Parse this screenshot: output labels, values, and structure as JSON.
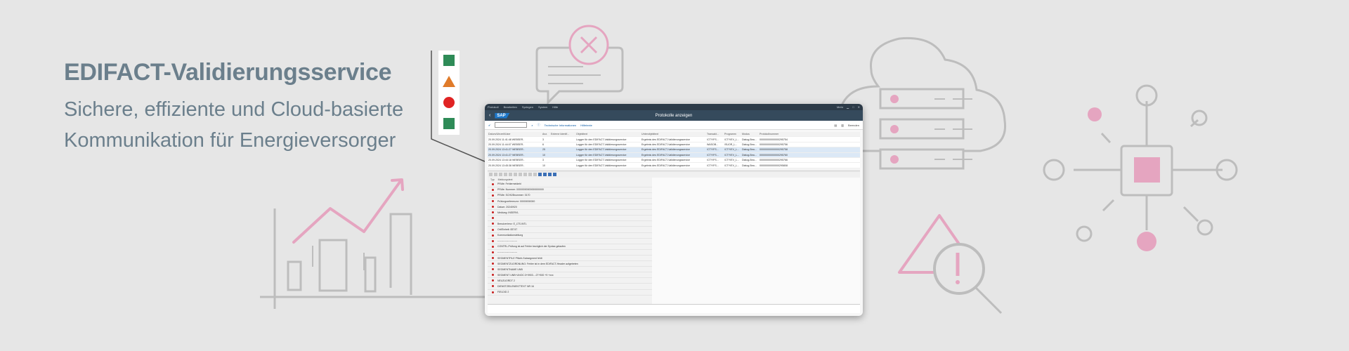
{
  "hero": {
    "headline": "EDIFACT-Validierungsservice",
    "subline_1": "Sichere, effiziente und Cloud-basierte",
    "subline_2": "Kommunikation für Energieversorger"
  },
  "colors": {
    "background": "#e6e6e6",
    "text": "#6b7f8c",
    "accent_pink": "#e5a5c0",
    "line_gray": "#bdbdbd",
    "status_green": "#2e8b57",
    "status_orange": "#e07b2a",
    "status_red": "#e02323",
    "sap_header": "#354a5c",
    "sap_blue": "#1d77c9"
  },
  "status_legend": {
    "icons": [
      "green-square-icon",
      "orange-triangle-icon",
      "red-circle-icon",
      "green-square-icon"
    ]
  },
  "sap": {
    "menu": [
      "Protokoll",
      "Bearbeiten",
      "Springen",
      "System",
      "Hilfe"
    ],
    "menu_right": "Mehr",
    "logo": "SAP",
    "title": "Protokolle anzeigen",
    "toolbar": {
      "technical_info": "Technische Informationen",
      "help": "Hilfetexte",
      "more": "Beenden"
    },
    "columns": [
      "Datum/Uhrzeit/User",
      "Anz.",
      "Externe Identif...",
      "Objekttext",
      "Unterobjekttext",
      "Transakt...",
      "Programm",
      "Modus",
      "Protokollnummer"
    ],
    "rows": [
      [
        "20.09.2024  11:41:48  WEBSER..",
        "3",
        "",
        "Logger für den EDIFACT-Validierungsservice",
        "Ergebnis des EDIFACT-Validierungsservice",
        "/CTY/FS...",
        "/CTY/EV_L...",
        "Dialog-Bea...",
        "00000000000000295754"
      ],
      [
        "20.09.2024  11:44:07  WEBSER..",
        "6",
        "",
        "Logger für den EDIFACT-Validierungsservice",
        "Ergebnis des EDIFACT-Validierungsservice",
        "WASOB...",
        "/SUOR_L...",
        "Dialog-Bea...",
        "00000000000000295756"
      ],
      [
        "20.09.2024  13:41:27  WEBSER..",
        "25",
        "",
        "Logger für den EDIFACT-Validierungsservice",
        "Ergebnis des EDIFACT-Validierungsservice",
        "/CTY/FS...",
        "/CTY/EV_L...",
        "Dialog-Bea...",
        "00000000000000295758"
      ],
      [
        "20.09.2024  13:41:27  WEBSER..",
        "10",
        "",
        "Logger für den EDIFACT-Validierungsservice",
        "Ergebnis des EDIFACT-Validierungsservice",
        "/CTY/FS...",
        "/CTY/EV_L...",
        "Dialog-Bea...",
        "00000000000000295760"
      ],
      [
        "20.09.2024  13:44:18  WEBSER..",
        "3",
        "",
        "Logger für den EDIFACT-Validierungsservice",
        "Ergebnis des EDIFACT-Validierungsservice",
        "/CTY/FS...",
        "/CTY/EV_L...",
        "Dialog-Bea...",
        "00000000000000295766"
      ],
      [
        "20.09.2024  13:45:38  WEBSER..",
        "10",
        "",
        "Logger für den EDIFACT-Validierungsservice",
        "Ergebnis des EDIFACT-Validierungsservice",
        "/CTY/FS...",
        "/CTY/EV_L...",
        "Dialog-Bea...",
        "00000000000000295808"
      ]
    ],
    "log_header": [
      "Typ",
      "Meldungstext"
    ],
    "log_lines": [
      "PRüfe: Fehlermeldehl",
      "PRüfe: Nummer: 00000000000000000000",
      "PRüfe: SCHÜBnummer: 0170",
      "Prüfungsreferenznr: 00000000000",
      "Datum: 20240920",
      "Meldung: INSERVL",
      "",
      "Benutzer/env: E_LTS.INTL",
      "Ort/Einheit: 83747",
      "Kommunikationsleitung",
      "------------------------",
      "CONTRL-Prüfung ist auf Fehler bezüglich der Syntax gelaufen",
      "------------------------",
      "SEGMENTFILE Pflicht-Subsegment fehlt",
      "SEGMENTZUORDNUNG: Fehler ist in dem EDIFACT-Header aufgetreten",
      "SEGMENTNAME UNB",
      "SEGMENT UNB+UNOC:3+9903...:27+500 +9 +xxx",
      "NEUZUORDT 2",
      "DIENSTZEILENENTTEXT NR 16",
      "FIELDID 2"
    ]
  }
}
